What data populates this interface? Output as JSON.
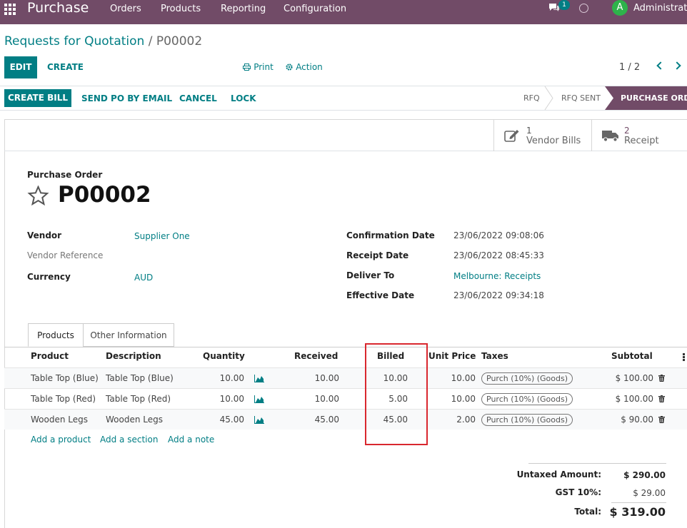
{
  "topnav": {
    "app_name": "Purchase",
    "menu": [
      "Orders",
      "Products",
      "Reporting",
      "Configuration"
    ],
    "chat_badge": "1",
    "avatar_initial": "A",
    "user": "Administrator",
    "bg_color": "#714b67"
  },
  "breadcrumb": {
    "parent": "Requests for Quotation",
    "separator": "/",
    "current": "P00002"
  },
  "control": {
    "edit": "EDIT",
    "create": "CREATE",
    "print": "Print",
    "action": "Action",
    "pager": "1 / 2"
  },
  "statusbar": {
    "buttons": [
      "CREATE BILL",
      "SEND PO BY EMAIL",
      "CANCEL",
      "LOCK"
    ],
    "stages": [
      "RFQ",
      "RFQ SENT"
    ],
    "active_stage": "PURCHASE ORDER"
  },
  "smart_buttons": [
    {
      "count": "1",
      "label": "Vendor Bills",
      "icon": "pencil-square-icon"
    },
    {
      "count": "2",
      "label": "Receipt",
      "icon": "truck-icon"
    }
  ],
  "form": {
    "type_label": "Purchase Order",
    "name": "P00002",
    "left": [
      {
        "label": "Vendor",
        "value": "Supplier One",
        "link": true
      },
      {
        "label": "Vendor Reference",
        "value": "",
        "link": false
      },
      {
        "label": "Currency",
        "value": "AUD",
        "link": true
      }
    ],
    "right": [
      {
        "label": "Confirmation Date",
        "value": "23/06/2022 09:08:06",
        "link": false
      },
      {
        "label": "Receipt Date",
        "value": "23/06/2022 08:45:33",
        "link": false
      },
      {
        "label": "Deliver To",
        "value": "Melbourne: Receipts",
        "link": true
      },
      {
        "label": "Effective Date",
        "value": "23/06/2022 09:34:18",
        "link": false
      }
    ]
  },
  "tabs": [
    "Products",
    "Other Information"
  ],
  "table": {
    "headers": [
      "Product",
      "Description",
      "Quantity",
      "Received",
      "Billed",
      "Unit Price",
      "Taxes",
      "Subtotal"
    ],
    "rows": [
      {
        "product": "Table Top (Blue)",
        "description": "Table Top (Blue)",
        "quantity": "10.00",
        "received": "10.00",
        "billed": "10.00",
        "unit_price": "10.00",
        "tax": "Purch (10%) (Goods)",
        "subtotal": "$ 100.00"
      },
      {
        "product": "Table Top (Red)",
        "description": "Table Top (Red)",
        "quantity": "10.00",
        "received": "10.00",
        "billed": "5.00",
        "unit_price": "10.00",
        "tax": "Purch (10%) (Goods)",
        "subtotal": "$ 100.00"
      },
      {
        "product": "Wooden Legs",
        "description": "Wooden Legs",
        "quantity": "45.00",
        "received": "45.00",
        "billed": "45.00",
        "unit_price": "2.00",
        "tax": "Purch (10%) (Goods)",
        "subtotal": "$ 90.00"
      }
    ],
    "add_links": [
      "Add a product",
      "Add a section",
      "Add a note"
    ]
  },
  "totals": {
    "untaxed_label": "Untaxed Amount:",
    "untaxed_value": "$ 290.00",
    "gst_label": "GST 10%:",
    "gst_value": "$ 29.00",
    "total_label": "Total:",
    "total_value": "$ 319.00"
  }
}
